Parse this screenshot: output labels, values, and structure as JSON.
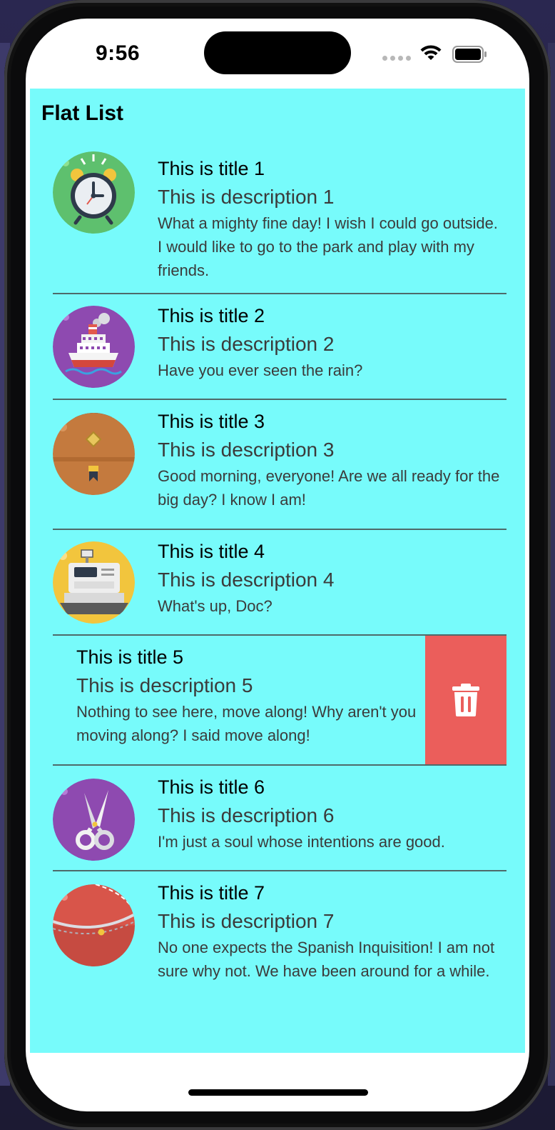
{
  "status_bar": {
    "time": "9:56"
  },
  "app": {
    "title": "Flat List",
    "background": "#77fbfb",
    "delete_color": "#eb5e5b"
  },
  "items": [
    {
      "title": "This is title 1",
      "description": "This is description 1",
      "body": "What a mighty fine day! I wish I could go outside. I would like to go to the park and play with my friends.",
      "icon": "alarm-clock-icon"
    },
    {
      "title": "This is title 2",
      "description": "This is description 2",
      "body": "Have you ever seen the rain?",
      "icon": "ship-icon"
    },
    {
      "title": "This is title 3",
      "description": "This is description 3",
      "body": "Good morning, everyone! Are we all ready for the big day? I know I am!",
      "icon": "briefcase-icon"
    },
    {
      "title": "This is title 4",
      "description": "This is description 4",
      "body": "What's up, Doc?",
      "icon": "cash-register-icon"
    },
    {
      "title": "This is title 5",
      "description": "This is description 5",
      "body": "Nothing to see here, move along! Why aren't you moving along? I said move along!",
      "icon": "trash-icon",
      "swiped": true
    },
    {
      "title": "This is title 6",
      "description": "This is description 6",
      "body": "I'm just a soul whose intentions are good.",
      "icon": "scissors-icon"
    },
    {
      "title": "This is title 7",
      "description": "This is description 7",
      "body": "No one expects the Spanish Inquisition! I am not sure why not. We have been around for a while.",
      "icon": "cricket-ball-icon"
    }
  ]
}
